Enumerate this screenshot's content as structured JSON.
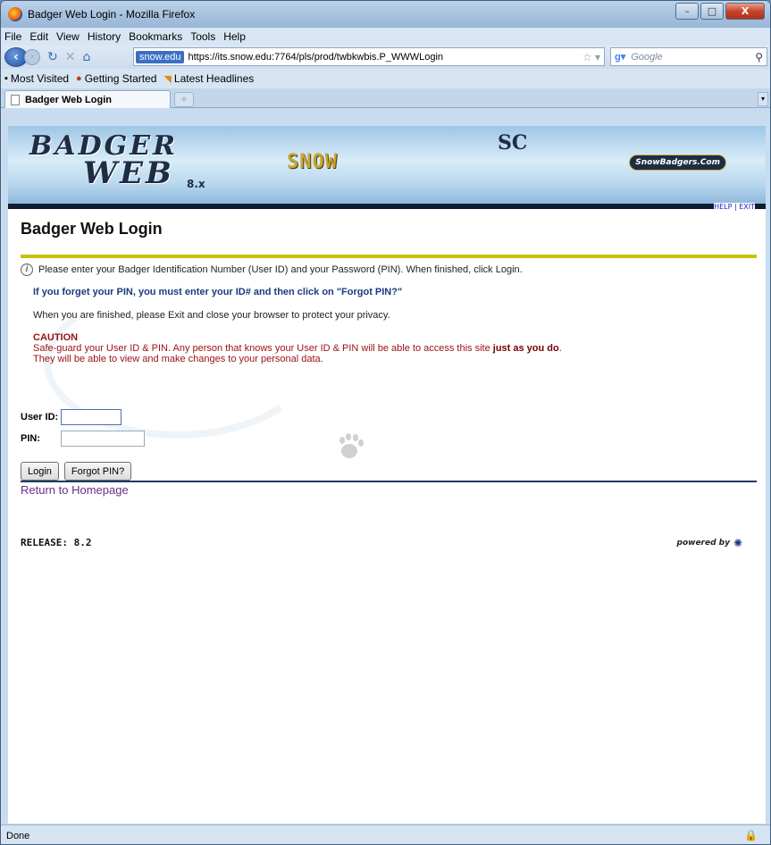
{
  "window": {
    "title": "Badger Web Login - Mozilla Firefox"
  },
  "menu": [
    "File",
    "Edit",
    "View",
    "History",
    "Bookmarks",
    "Tools",
    "Help"
  ],
  "nav": {
    "site_identity": "snow.edu",
    "url": "https://its.snow.edu:7764/pls/prod/twbkwbis.P_WWWLogin",
    "search_placeholder": "Google"
  },
  "bookmarks": [
    "Most Visited",
    "Getting Started",
    "Latest Headlines"
  ],
  "tab": {
    "label": "Badger Web Login"
  },
  "banner": {
    "logo_line1": "BADGER",
    "logo_line2": "WEB",
    "version": "8.x",
    "snow": "SNOW",
    "sc": "SC",
    "snowbadgers": "SnowBadgers.Com",
    "help": "HELP",
    "exit": "EXIT"
  },
  "page": {
    "title": "Badger Web Login",
    "info": "Please enter your Badger Identification Number (User ID) and your Password (PIN). When finished, click Login.",
    "forget": "If you forget your PIN, you must enter your ID# and then click on \"Forgot PIN?\"",
    "finished": "When you are finished, please Exit and close your browser to protect your privacy.",
    "caution_heading": "CAUTION",
    "caution_line1_a": "Safe-guard your User ID & PIN. Any person that knows your User ID & PIN will be able to access this site ",
    "caution_line1_b": "just as you do",
    "caution_line1_c": ".",
    "caution_line2": "They will be able to view and make changes to your personal data."
  },
  "form": {
    "user_label": "User ID:",
    "user_value": "",
    "pin_label": "PIN:",
    "pin_value": "",
    "login_button": "Login",
    "forgot_button": "Forgot PIN?"
  },
  "links": {
    "home": "Return to Homepage"
  },
  "footer": {
    "release": "RELEASE: 8.2",
    "powered_by": "powered by"
  },
  "status": {
    "text": "Done"
  }
}
